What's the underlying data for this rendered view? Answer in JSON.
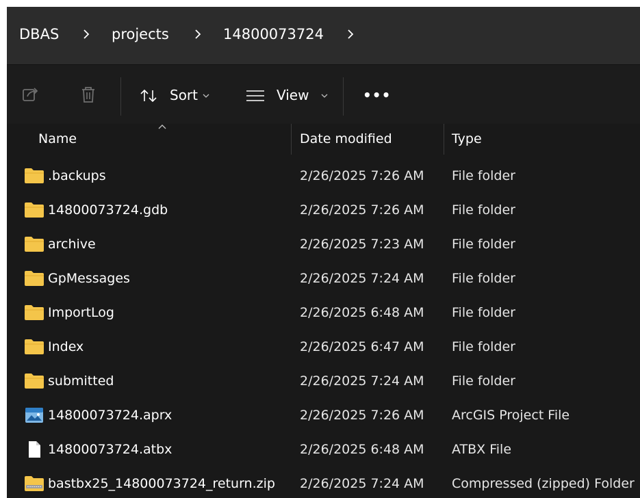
{
  "breadcrumb": {
    "items": [
      "DBAS",
      "projects",
      "14800073724"
    ]
  },
  "toolbar": {
    "share_icon": "share-icon",
    "delete_icon": "trash-icon",
    "sort_label": "Sort",
    "view_label": "View",
    "more_label": "•••"
  },
  "columns": {
    "name": "Name",
    "date": "Date modified",
    "type": "Type"
  },
  "files": [
    {
      "name": ".backups",
      "date": "2/26/2025 7:26 AM",
      "type": "File folder",
      "icon": "folder-icon"
    },
    {
      "name": "14800073724.gdb",
      "date": "2/26/2025 7:26 AM",
      "type": "File folder",
      "icon": "folder-icon"
    },
    {
      "name": "archive",
      "date": "2/26/2025 7:23 AM",
      "type": "File folder",
      "icon": "folder-icon"
    },
    {
      "name": "GpMessages",
      "date": "2/26/2025 7:24 AM",
      "type": "File folder",
      "icon": "folder-icon"
    },
    {
      "name": "ImportLog",
      "date": "2/26/2025 6:48 AM",
      "type": "File folder",
      "icon": "folder-icon"
    },
    {
      "name": "Index",
      "date": "2/26/2025 6:47 AM",
      "type": "File folder",
      "icon": "folder-icon"
    },
    {
      "name": "submitted",
      "date": "2/26/2025 7:24 AM",
      "type": "File folder",
      "icon": "folder-icon"
    },
    {
      "name": "14800073724.aprx",
      "date": "2/26/2025 7:26 AM",
      "type": "ArcGIS Project File",
      "icon": "arcgis-project-icon"
    },
    {
      "name": "14800073724.atbx",
      "date": "2/26/2025 6:48 AM",
      "type": "ATBX File",
      "icon": "document-icon"
    },
    {
      "name": "bastbx25_14800073724_return.zip",
      "date": "2/26/2025 7:24 AM",
      "type": "Compressed (zipped) Folder",
      "icon": "zip-folder-icon"
    }
  ],
  "colors": {
    "background": "#191919",
    "addressbar": "#2c2c2c",
    "folder": "#f4c54a",
    "text": "#ffffff"
  }
}
